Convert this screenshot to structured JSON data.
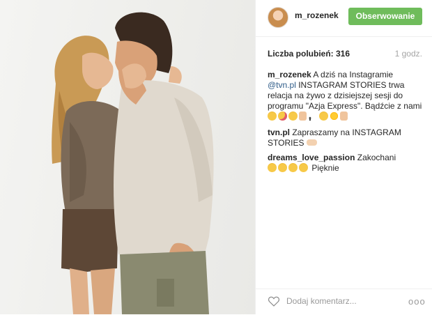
{
  "post": {
    "username": "m_rozenek",
    "follow_label": "Obserwowanie",
    "likes_label": "Liczba polubień: 316",
    "time_ago": "1 godz.",
    "comments": [
      {
        "user": "m_rozenek",
        "text_before": " A dziś na Instagramie ",
        "mention": "@tvn.pl",
        "text_after": " INSTAGRAM STORIES trwa relacja na żywo z dzisiejszej sesji do programu \"Azja Express\". Bądźcie z nami"
      },
      {
        "user": "tvn.pl",
        "text": " Zapraszamy na INSTAGRAM STORIES"
      },
      {
        "user": "dreams_love_passion",
        "text": " Zakochani",
        "text_after": " Pięknie"
      }
    ],
    "comment_placeholder": "Dodaj komentarz...",
    "more_label": "ooo"
  },
  "icons": {
    "like": "heart-outline-icon",
    "more": "more-options-icon",
    "avatar": "user-avatar"
  },
  "colors": {
    "follow_button": "#6fbc5b",
    "mention": "#2e5b88",
    "muted": "#a5a5a5"
  }
}
